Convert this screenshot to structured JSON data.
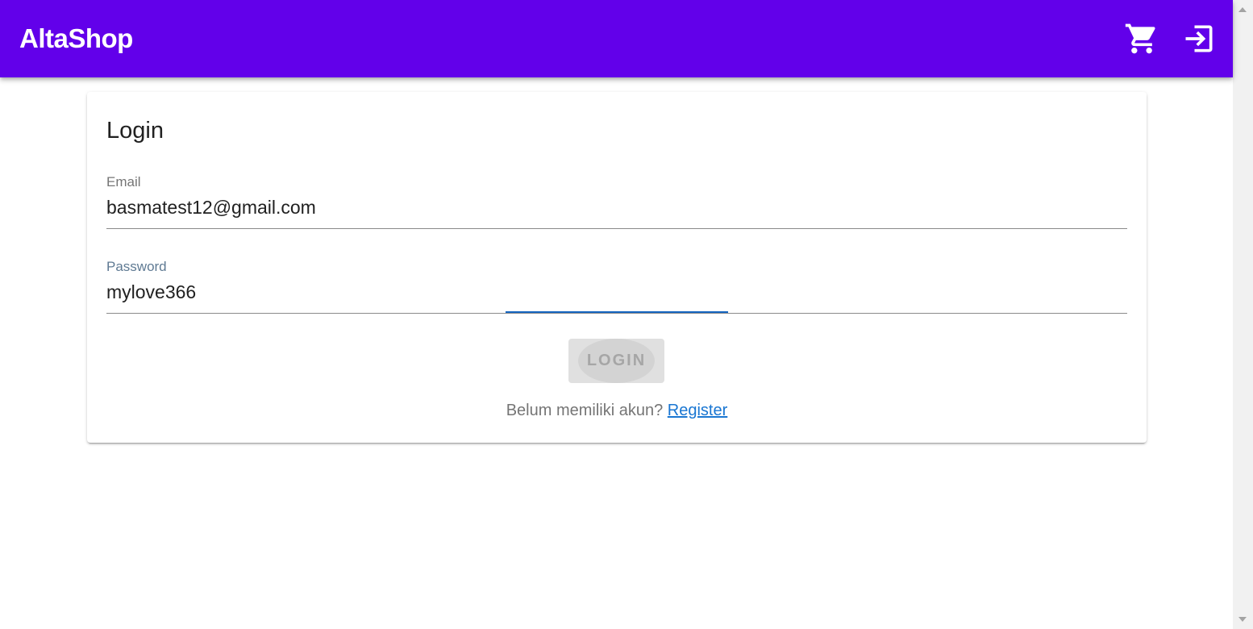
{
  "app_bar": {
    "title": "AltaShop",
    "background_color": "#6200ea",
    "icons": [
      "cart-icon",
      "login-icon"
    ]
  },
  "login_card": {
    "title": "Login",
    "email": {
      "label": "Email",
      "value": "basmatest12@gmail.com"
    },
    "password": {
      "label": "Password",
      "value": "mylove366"
    },
    "submit_label": "LOGIN",
    "register_prompt": "Belum memiliki akun?",
    "register_link": "Register"
  },
  "colors": {
    "accent": "#6200ea",
    "link": "#1976d2",
    "focus_underline": "#1565c0",
    "disabled_button": "#e0e0e0"
  }
}
